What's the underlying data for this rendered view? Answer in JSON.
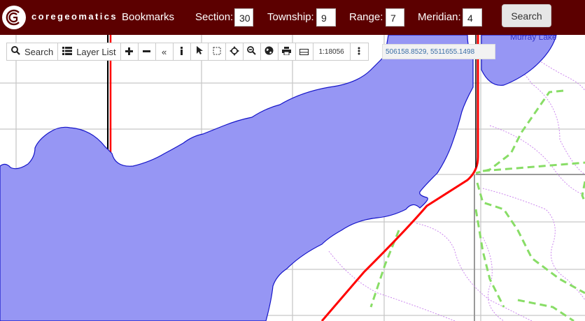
{
  "header": {
    "logo_text": "coregeomatics",
    "bookmarks_label": "Bookmarks",
    "section_label": "Section:",
    "section_value": "30",
    "township_label": "Township:",
    "township_value": "9",
    "range_label": "Range:",
    "range_value": "7",
    "meridian_label": "Meridian:",
    "meridian_value": "4",
    "search_button": "Search"
  },
  "toolbar": {
    "search_label": "Search",
    "layer_list_label": "Layer List",
    "scale": "1:18056",
    "coordinates": "506158.8529, 5511655.1498",
    "icons": [
      "search-icon",
      "list-icon",
      "zoom-in-icon",
      "zoom-out-icon",
      "collapse-icon",
      "info-icon",
      "pointer-icon",
      "select-box-icon",
      "pan-icon",
      "zoom-extent-icon",
      "globe-icon",
      "print-icon",
      "measure-icon",
      "more-icon"
    ]
  },
  "map": {
    "lake_label": "Murray Lake",
    "colors": {
      "water": "#9696f4",
      "water_outline": "#1414c8",
      "road": "#ff0000",
      "trail": "#88dd66",
      "boundary": "#cc88ee",
      "grid": "#c8c8c8",
      "header": "#5c0000"
    }
  }
}
